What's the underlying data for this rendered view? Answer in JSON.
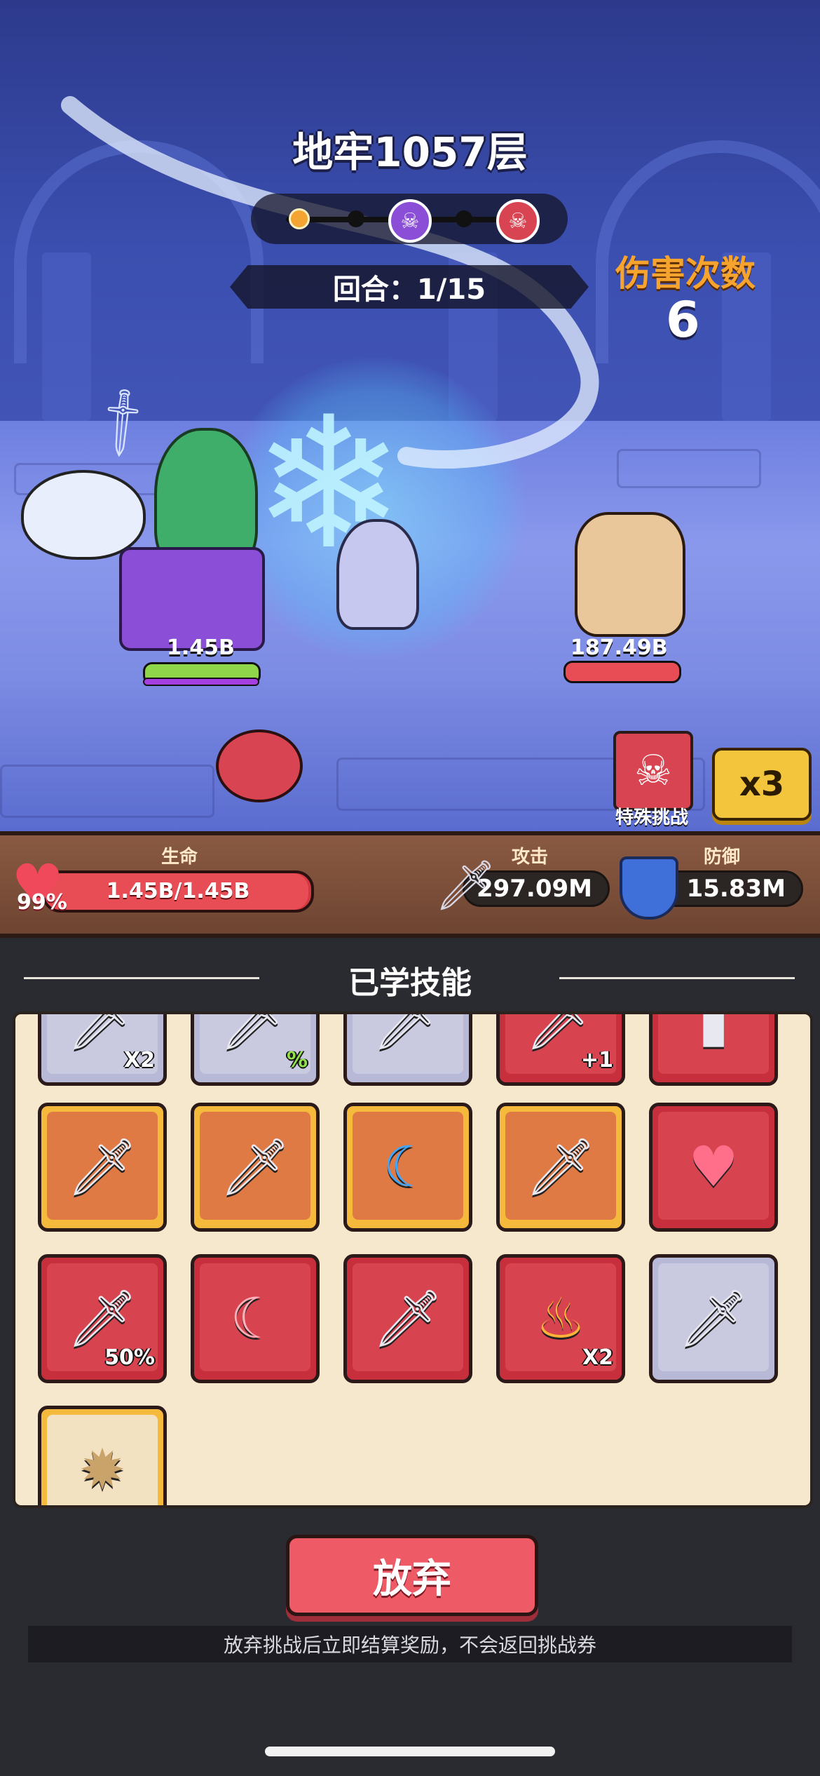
{
  "dungeon": {
    "title": "地牢1057层"
  },
  "round": {
    "label": "回合：1/15"
  },
  "damage": {
    "label": "伤害次数",
    "count": "6"
  },
  "battle": {
    "player_hp": "1.45B",
    "enemy_hp": "187.49B"
  },
  "special": {
    "label": "特殊挑战"
  },
  "speed": {
    "label": "x3"
  },
  "stats": {
    "life_label": "生命",
    "life_value": "1.45B/1.45B",
    "life_percent": "99%",
    "life_fraction": 0.99,
    "attack_label": "攻击",
    "attack_value": "297.09M",
    "defense_label": "防御",
    "defense_value": "15.83M"
  },
  "skills_panel": {
    "title": "已学技能",
    "skills": [
      {
        "tag": "X2"
      },
      {
        "tag": "%"
      },
      {
        "tag": ""
      },
      {
        "tag": "+1"
      },
      {
        "tag": ""
      },
      {
        "tag": ""
      },
      {
        "tag": ""
      },
      {
        "tag": ""
      },
      {
        "tag": ""
      },
      {
        "tag": ""
      },
      {
        "tag": "50%"
      },
      {
        "tag": ""
      },
      {
        "tag": ""
      },
      {
        "tag": "X2"
      },
      {
        "tag": ""
      },
      {
        "tag": ""
      }
    ]
  },
  "actions": {
    "abandon": "放弃",
    "notice": "放弃挑战后立即结算奖励，不会返回挑战券"
  },
  "colors": {
    "accent": "#f7a42f",
    "danger": "#ee5a66",
    "panel": "#f5e8cc"
  }
}
